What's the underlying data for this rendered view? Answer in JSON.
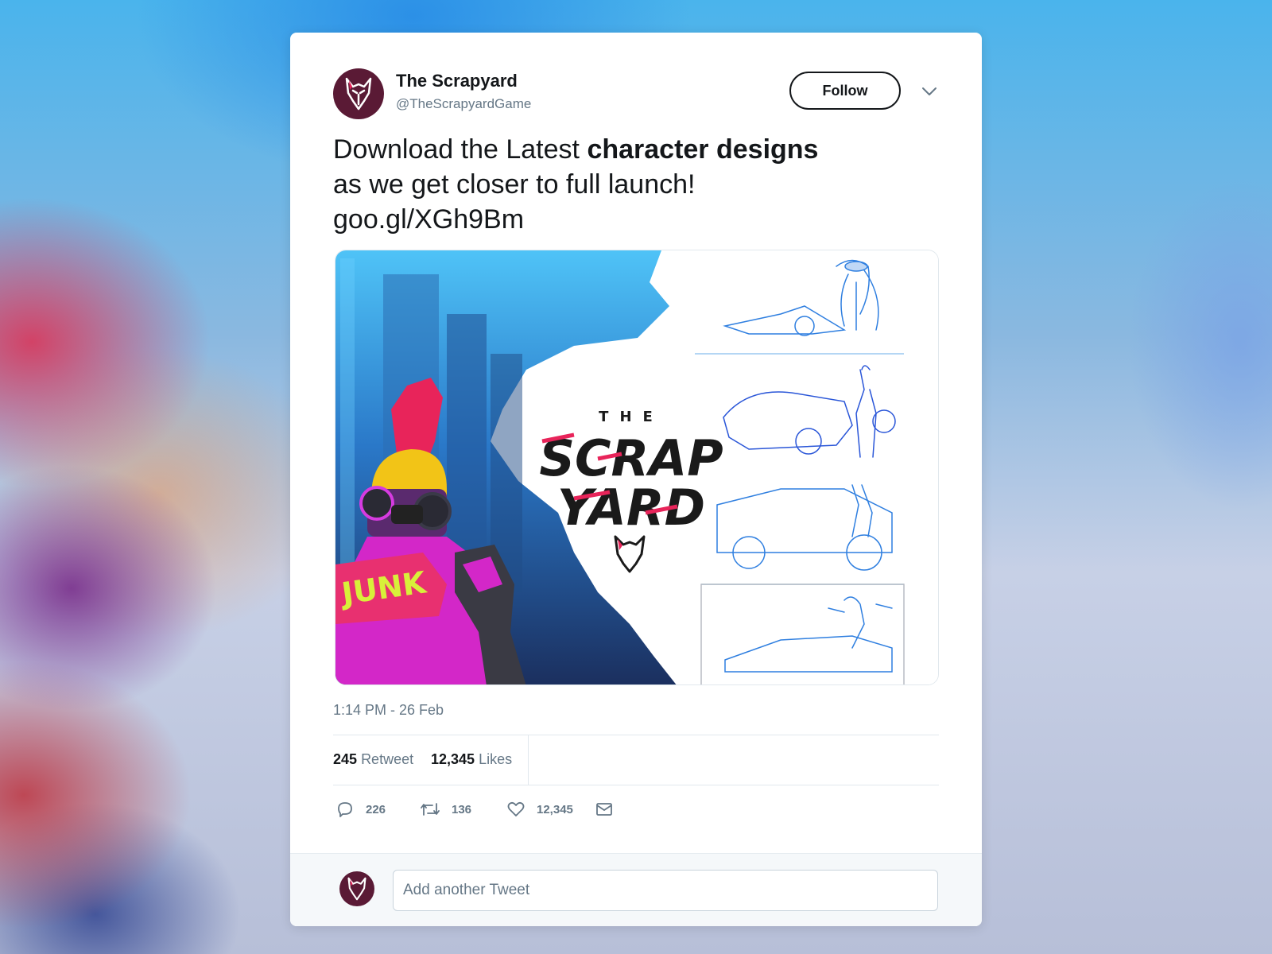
{
  "account": {
    "name": "The Scrapyard",
    "handle": "@TheScrapyardGame",
    "avatar_color": "#5a1a35"
  },
  "header": {
    "follow_label": "Follow",
    "caret_icon": "chevron-down-icon"
  },
  "tweet": {
    "text_part1": "Download the Latest ",
    "text_bold": "character designs",
    "text_line2": "as we get closer to full launch!",
    "link": "goo.gl/XGh9Bm"
  },
  "media": {
    "logo_line1": "THE",
    "logo_line2": "SCRAP",
    "logo_line3": "YARD",
    "shirt_text": "JUNK"
  },
  "meta": {
    "timestamp": "1:14 PM - 26 Feb"
  },
  "stats": {
    "retweets_count": "245",
    "retweets_label": "Retweet",
    "likes_count": "12,345",
    "likes_label": "Likes"
  },
  "actions": {
    "reply_count": "226",
    "retweet_count": "136",
    "like_count": "12,345"
  },
  "reply": {
    "placeholder": "Add another Tweet"
  },
  "colors": {
    "text": "#14171a",
    "muted": "#657786",
    "border": "#e1e8ed",
    "logo_accent": "#e8245a"
  }
}
